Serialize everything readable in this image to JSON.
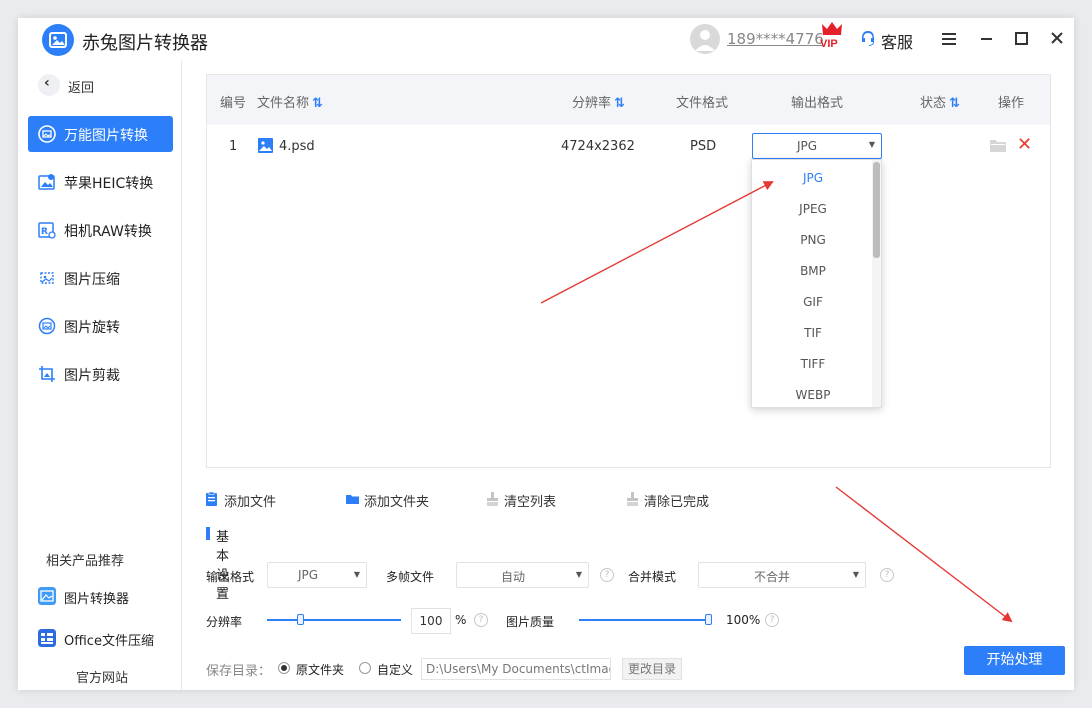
{
  "titlebar": {
    "app_title": "赤兔图片转换器",
    "username": "189****4776",
    "vip_label": "VIP",
    "service_label": "客服",
    "icons": [
      "app-logo",
      "avatar",
      "vip-crown",
      "headset-icon",
      "menu-icon",
      "minimize-icon",
      "maximize-icon",
      "close-icon"
    ]
  },
  "sidebar": {
    "back_label": "返回",
    "items": [
      {
        "label": "万能图片转换",
        "icon": "image-convert-icon",
        "active": true
      },
      {
        "label": "苹果HEIC转换",
        "icon": "heic-icon",
        "active": false
      },
      {
        "label": "相机RAW转换",
        "icon": "raw-icon",
        "active": false
      },
      {
        "label": "图片压缩",
        "icon": "compress-icon",
        "active": false
      },
      {
        "label": "图片旋转",
        "icon": "rotate-icon",
        "active": false
      },
      {
        "label": "图片剪裁",
        "icon": "crop-icon",
        "active": false
      }
    ],
    "related_title": "相关产品推荐",
    "related": [
      {
        "label": "图片转换器",
        "icon": "image-converter-app-icon"
      },
      {
        "label": "Office文件压缩",
        "icon": "office-compress-app-icon"
      }
    ],
    "official_site": "官方网站"
  },
  "table": {
    "headers": {
      "index": "编号",
      "filename": "文件名称",
      "resolution": "分辨率",
      "file_format": "文件格式",
      "output_format": "输出格式",
      "status": "状态",
      "action": "操作"
    },
    "rows": [
      {
        "index": "1",
        "filename": "4.psd",
        "resolution": "4724x2362",
        "file_format": "PSD",
        "output_format": "JPG",
        "status": ""
      }
    ]
  },
  "format_dropdown": {
    "selected": "JPG",
    "options": [
      "JPG",
      "JPEG",
      "PNG",
      "BMP",
      "GIF",
      "TIF",
      "TIFF",
      "WEBP"
    ]
  },
  "toolbar": {
    "add_file": "添加文件",
    "add_folder": "添加文件夹",
    "clear_list": "清空列表",
    "clear_done": "清除已完成"
  },
  "settings": {
    "section_title": "基本设置",
    "output_format_label": "输出格式",
    "output_format_value": "JPG",
    "multiframe_label": "多帧文件",
    "multiframe_value": "自动",
    "merge_label": "合并模式",
    "merge_value": "不合并",
    "resolution_label": "分辨率",
    "resolution_value": "100",
    "resolution_unit": "%",
    "quality_label": "图片质量",
    "quality_value": "100%",
    "resolution_slider_fraction": 0.25,
    "quality_slider_fraction": 1.0
  },
  "save": {
    "label": "保存目录：",
    "option_original": "原文件夹",
    "option_custom": "自定义",
    "selected": "原文件夹",
    "path": "D:\\Users\\My Documents\\ctImageC",
    "change_dir": "更改目录"
  },
  "start_button": "开始处理",
  "colors": {
    "accent": "#2d7ff9",
    "delete": "#e8392f",
    "annotation_arrow": "#e53935"
  }
}
